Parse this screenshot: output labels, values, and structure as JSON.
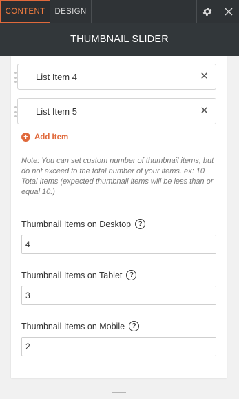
{
  "tabs": {
    "content": "CONTENT",
    "design": "DESIGN"
  },
  "icons": {
    "settings": "gear-icon",
    "close": "close-icon",
    "remove": "close-icon",
    "add": "plus-circle-icon",
    "help": "question-icon",
    "drag": "drag-handle-icon"
  },
  "header": {
    "title": "THUMBNAIL SLIDER"
  },
  "list": {
    "items": [
      {
        "label": "List Item 4"
      },
      {
        "label": "List Item 5"
      }
    ],
    "add_label": "Add Item"
  },
  "note": "Note: You can set custom number of thumbnail items, but do not exceed to the total number of your items. ex: 10 Total Items (expected thumbnail items will be less than or equal 10.)",
  "fields": [
    {
      "label": "Thumbnail Items on Desktop",
      "value": "4"
    },
    {
      "label": "Thumbnail Items on Tablet",
      "value": "3"
    },
    {
      "label": "Thumbnail Items on Mobile",
      "value": "2"
    }
  ],
  "colors": {
    "accent": "#e0693b",
    "topbar": "#2f3336",
    "titlebar": "#32373a"
  }
}
